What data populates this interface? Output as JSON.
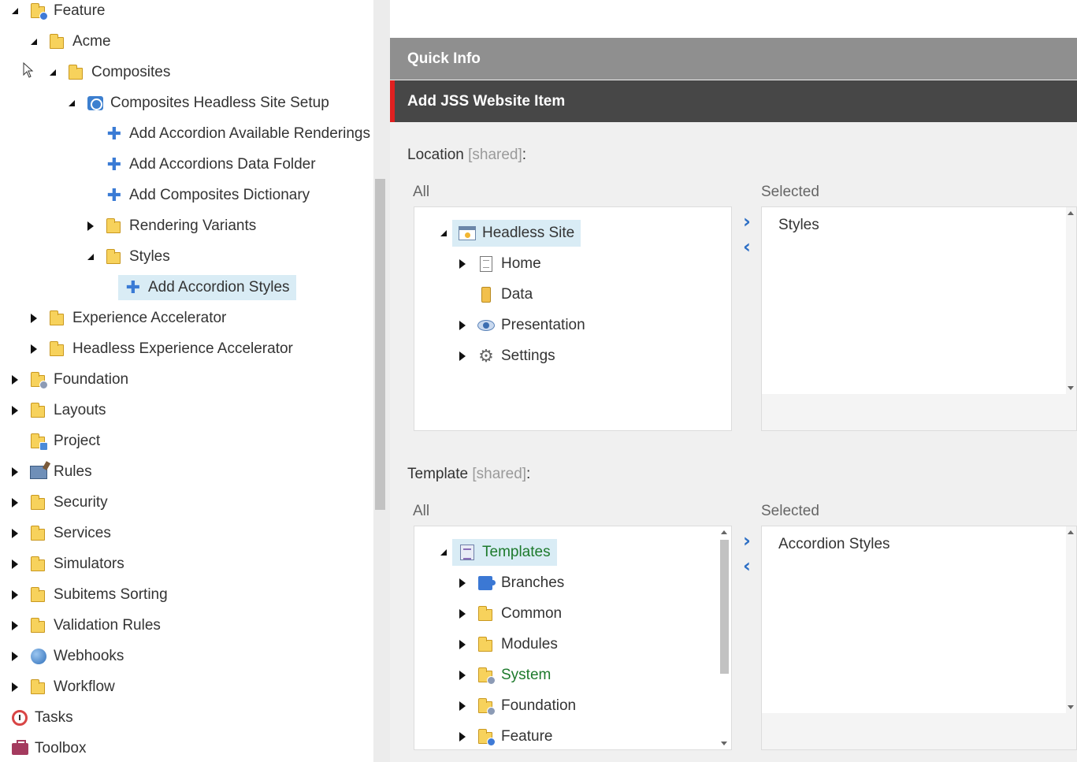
{
  "left_tree": {
    "items": [
      {
        "label": "Feature",
        "icon": "folder-feature-icon",
        "expanded": true
      },
      {
        "label": "Acme",
        "icon": "folder-icon",
        "expanded": true
      },
      {
        "label": "Composites",
        "icon": "folder-icon",
        "expanded": true
      },
      {
        "label": "Composites Headless Site Setup",
        "icon": "site-setup-icon",
        "expanded": true
      },
      {
        "label": "Add Accordion Available Renderings",
        "icon": "plus-icon"
      },
      {
        "label": "Add Accordions Data Folder",
        "icon": "plus-icon"
      },
      {
        "label": "Add Composites Dictionary",
        "icon": "plus-icon"
      },
      {
        "label": "Rendering Variants",
        "icon": "folder-icon",
        "expanded": false
      },
      {
        "label": "Styles",
        "icon": "folder-icon",
        "expanded": true
      },
      {
        "label": "Add Accordion Styles",
        "icon": "plus-icon",
        "selected": true
      },
      {
        "label": "Experience Accelerator",
        "icon": "folder-icon",
        "expanded": false
      },
      {
        "label": "Headless Experience Accelerator",
        "icon": "folder-icon",
        "expanded": false
      },
      {
        "label": "Foundation",
        "icon": "folder-gear-icon",
        "expanded": false
      },
      {
        "label": "Layouts",
        "icon": "folder-icon",
        "expanded": false
      },
      {
        "label": "Project",
        "icon": "folder-project-icon"
      },
      {
        "label": "Rules",
        "icon": "rules-icon",
        "expanded": false
      },
      {
        "label": "Security",
        "icon": "folder-icon",
        "expanded": false
      },
      {
        "label": "Services",
        "icon": "folder-icon",
        "expanded": false
      },
      {
        "label": "Simulators",
        "icon": "folder-icon",
        "expanded": false
      },
      {
        "label": "Subitems Sorting",
        "icon": "folder-icon",
        "expanded": false
      },
      {
        "label": "Validation Rules",
        "icon": "folder-icon",
        "expanded": false
      },
      {
        "label": "Webhooks",
        "icon": "globe-icon",
        "expanded": false
      },
      {
        "label": "Workflow",
        "icon": "folder-icon",
        "expanded": false
      },
      {
        "label": "Tasks",
        "icon": "clock-icon"
      },
      {
        "label": "Toolbox",
        "icon": "toolbox-icon"
      }
    ]
  },
  "quick_info": "Quick Info",
  "section_title": "Add JSS Website Item",
  "location": {
    "label": "Location",
    "shared": "[shared]",
    "colon": ":",
    "all_label": "All",
    "selected_label": "Selected",
    "tree": [
      {
        "label": "Headless Site",
        "icon": "site-icon",
        "selected": true
      },
      {
        "label": "Home",
        "icon": "page-icon"
      },
      {
        "label": "Data",
        "icon": "data-icon"
      },
      {
        "label": "Presentation",
        "icon": "eye-icon"
      },
      {
        "label": "Settings",
        "icon": "gear-icon"
      }
    ],
    "selected_value": "Styles"
  },
  "template": {
    "label": "Template",
    "shared": "[shared]",
    "colon": ":",
    "all_label": "All",
    "selected_label": "Selected",
    "tree": [
      {
        "label": "Templates",
        "icon": "templates-icon",
        "selected": true
      },
      {
        "label": "Branches",
        "icon": "puzzle-icon"
      },
      {
        "label": "Common",
        "icon": "folder-icon"
      },
      {
        "label": "Modules",
        "icon": "folder-icon"
      },
      {
        "label": "System",
        "icon": "folder-gear-icon"
      },
      {
        "label": "Foundation",
        "icon": "folder-gear-icon"
      },
      {
        "label": "Feature",
        "icon": "folder-feature-icon"
      }
    ],
    "selected_value": "Accordion Styles"
  },
  "colors": {
    "selection_bg": "#d9ecf5",
    "accent_red": "#e02020",
    "arrow_blue": "#2d6fc5",
    "green_text": "#1d7a2c"
  }
}
